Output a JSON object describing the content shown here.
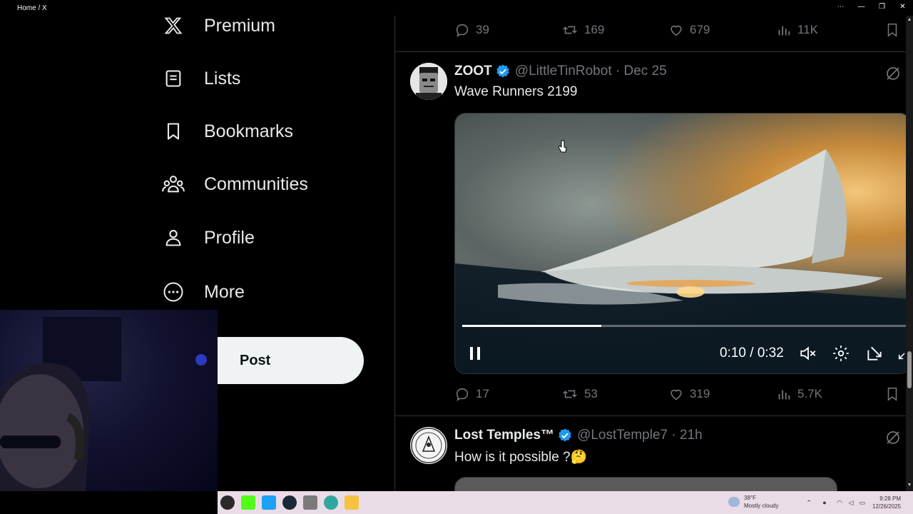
{
  "window": {
    "title": "Home / X",
    "controls": [
      "⋯",
      "—",
      "❐",
      "✕"
    ]
  },
  "nav": {
    "items": [
      {
        "label": "Premium",
        "icon": "x-logo-icon"
      },
      {
        "label": "Lists",
        "icon": "lists-icon"
      },
      {
        "label": "Bookmarks",
        "icon": "bookmark-icon"
      },
      {
        "label": "Communities",
        "icon": "communities-icon"
      },
      {
        "label": "Profile",
        "icon": "profile-icon"
      },
      {
        "label": "More",
        "icon": "more-icon"
      }
    ],
    "post_button": "Post"
  },
  "feed": {
    "prev_tweet_actions": {
      "replies": "39",
      "reposts": "169",
      "likes": "679",
      "views": "11K"
    },
    "tweet1": {
      "name": "ZOOT",
      "handle": "@LittleTinRobot · Dec 25",
      "text": "Wave Runners 2199",
      "video": {
        "time": "0:10 / 0:32",
        "progress": 0.31
      },
      "actions": {
        "replies": "17",
        "reposts": "53",
        "likes": "319",
        "views": "5.7K"
      }
    },
    "tweet2": {
      "name": "Lost Temples™",
      "handle": "@LostTemple7 · 21h",
      "text": "How is it possible ?🤔"
    }
  },
  "taskbar": {
    "weather_temp": "38°F",
    "weather_desc": "Mostly cloudy",
    "time": "9:28 PM",
    "date": "12/26/2025"
  },
  "colors": {
    "accent": "#1d9bf0",
    "muted": "#71767b",
    "text": "#e7e9ea"
  }
}
